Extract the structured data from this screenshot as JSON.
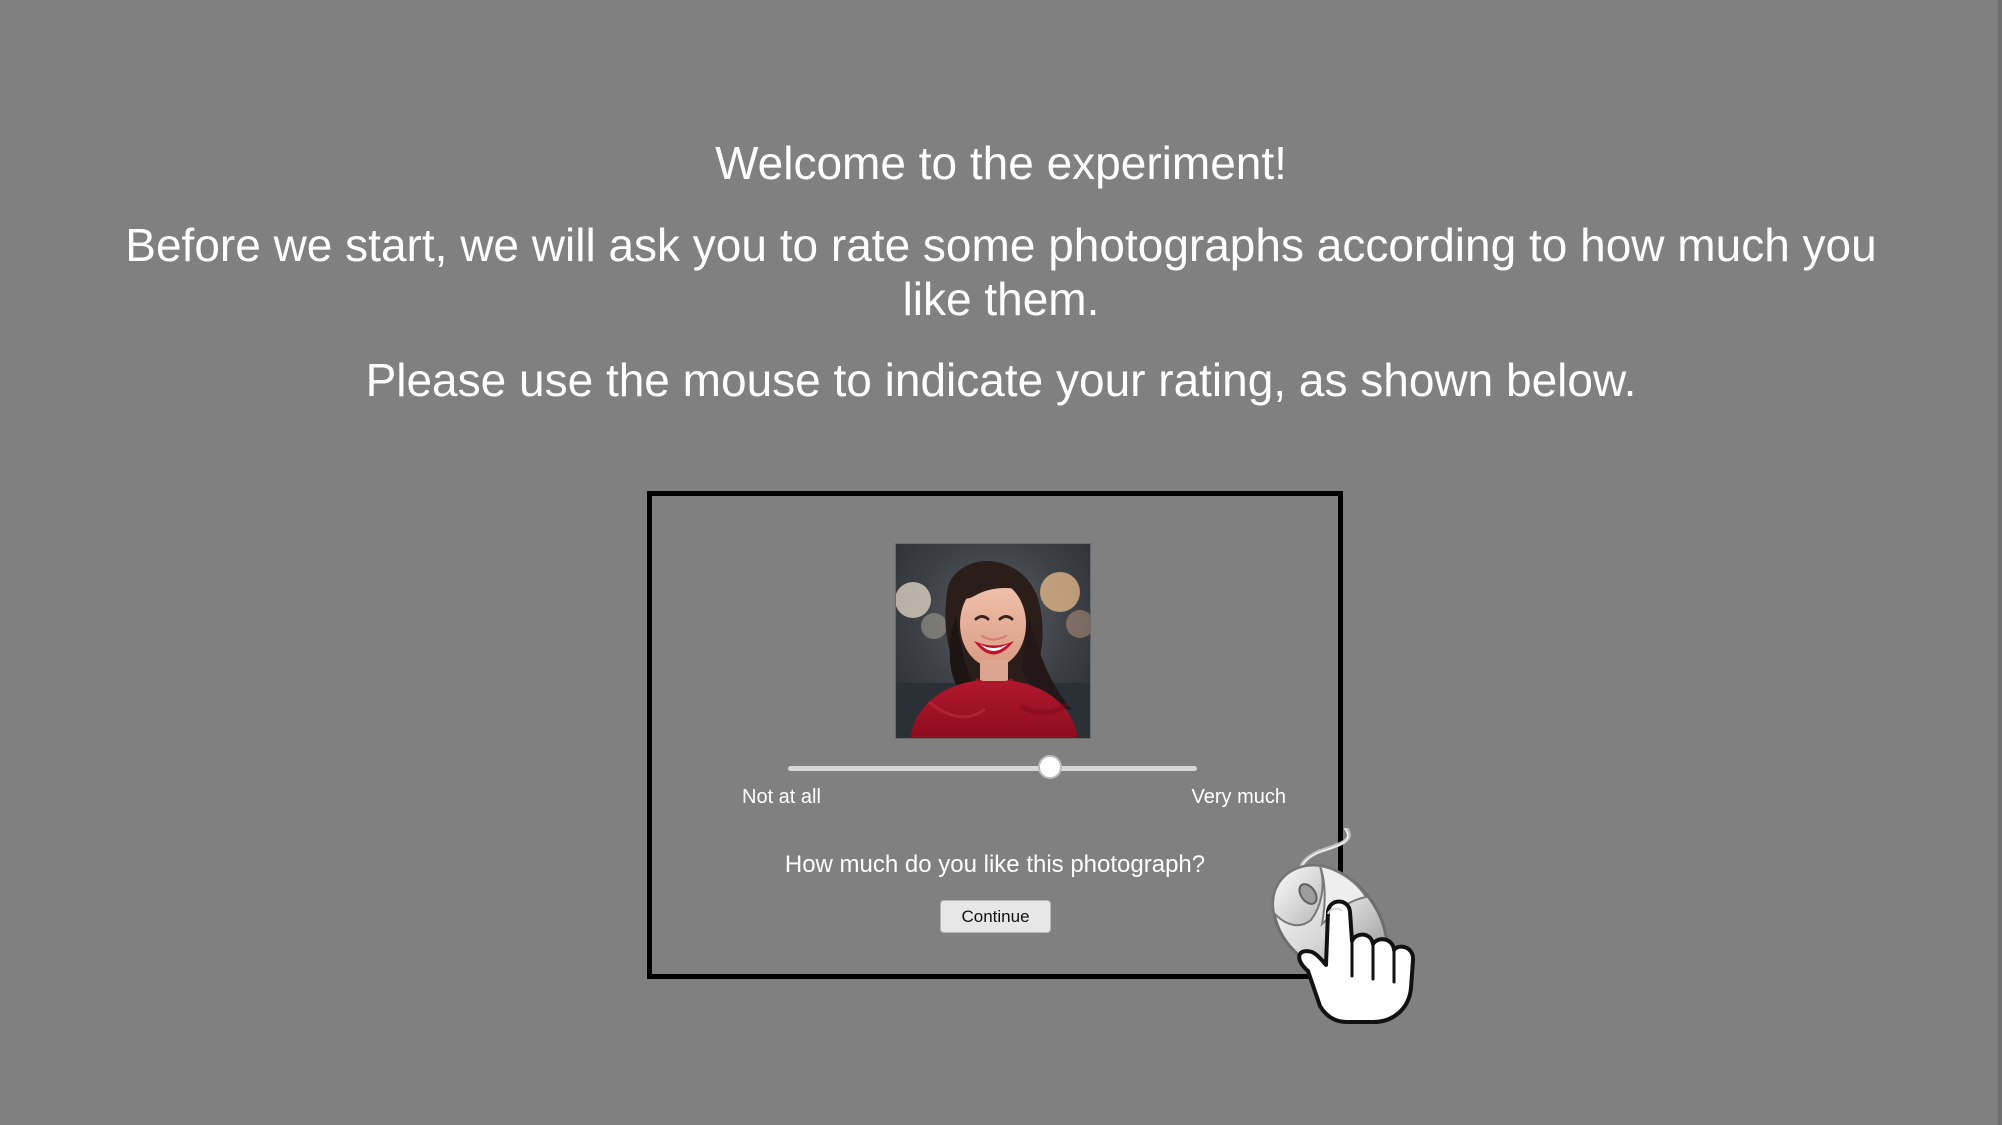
{
  "intro": {
    "title": "Welcome to the experiment!",
    "line_1": "Before we start, we will ask you to rate some photographs according to how much you",
    "line_2": "like them.",
    "line_3": "Please use the mouse to indicate your rating, as shown below."
  },
  "demo": {
    "slider": {
      "min_label": "Not at all",
      "max_label": "Very much",
      "value_fraction": 0.64
    },
    "question": "How much do you like this photograph?",
    "continue_label": "Continue"
  },
  "icons": {
    "photo": "smiling-woman-portrait",
    "pointer": "mouse-with-pointing-hand-icon"
  },
  "colors": {
    "background": "#808080",
    "text": "#ffffff",
    "frame": "#000000",
    "button": "#e7e7e7",
    "sweater_red": "#a80f23"
  }
}
